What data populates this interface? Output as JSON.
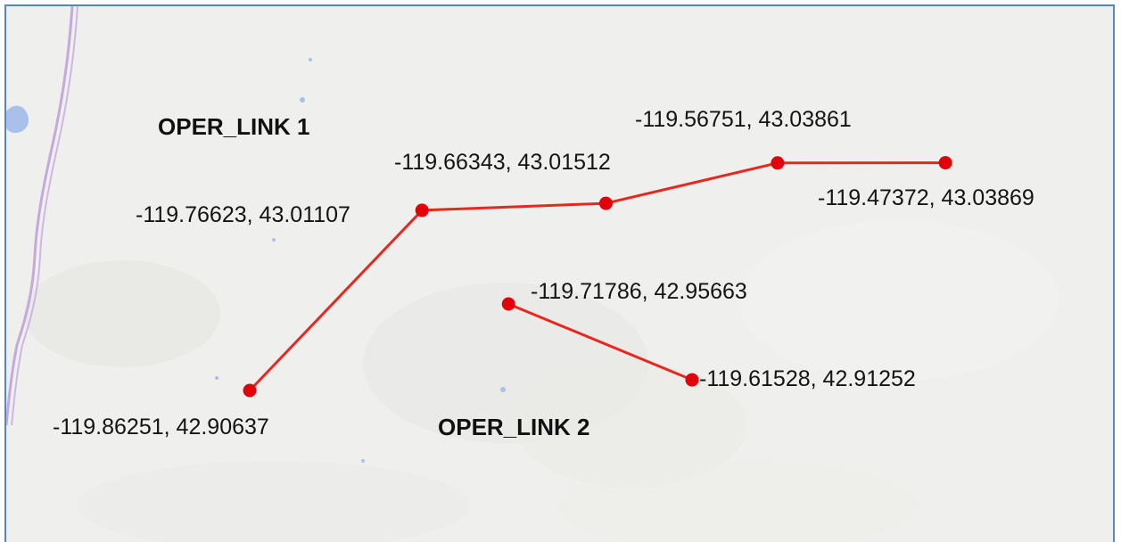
{
  "map": {
    "colors": {
      "background": "#efefed",
      "route": "#e8281e",
      "node": "#e3000b",
      "water": "#a9c1ea",
      "boundary_line": "#c6a9dc",
      "frame_border": "#5b84c4"
    },
    "links": [
      {
        "name": "OPER_LINK 1",
        "points": [
          {
            "lon": -119.86251,
            "lat": 42.90637,
            "label": "-119.86251, 42.90637"
          },
          {
            "lon": -119.76623,
            "lat": 43.01107,
            "label": "-119.76623, 43.01107"
          },
          {
            "lon": -119.66343,
            "lat": 43.01512,
            "label": "-119.66343, 43.01512"
          },
          {
            "lon": -119.56751,
            "lat": 43.03861,
            "label": "-119.56751, 43.03861"
          },
          {
            "lon": -119.47372,
            "lat": 43.03869,
            "label": "-119.47372, 43.03869"
          }
        ]
      },
      {
        "name": "OPER_LINK 2",
        "points": [
          {
            "lon": -119.71786,
            "lat": 42.95663,
            "label": "-119.71786, 42.95663"
          },
          {
            "lon": -119.61528,
            "lat": 42.91252,
            "label": "-119.61528, 42.91252"
          }
        ]
      }
    ]
  }
}
